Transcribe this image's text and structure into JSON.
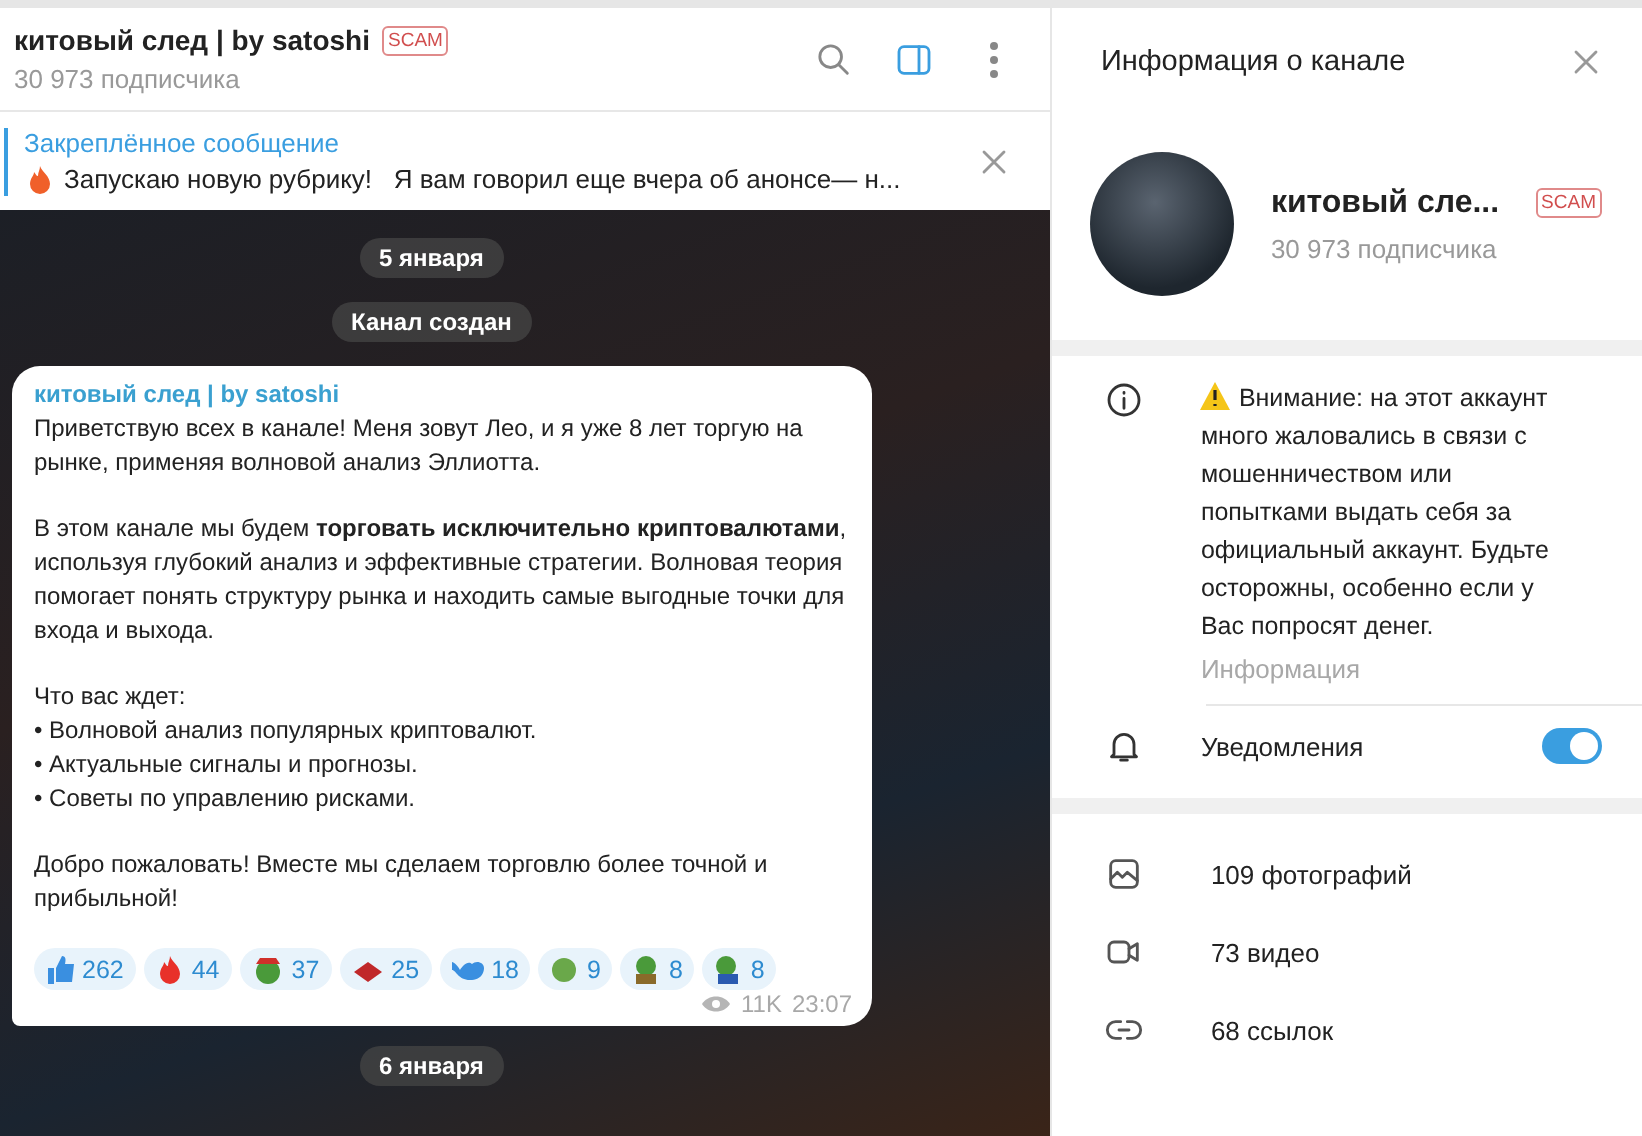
{
  "chat": {
    "title": "китовый след | by satoshi",
    "badge": "SCAM",
    "subtitle": "30 973 подписчика",
    "pinned": {
      "label": "Закреплённое сообщение",
      "text": "Запускаю новую рубрику!   Я вам говорил еще вчера об анонсе— н..."
    },
    "feed": [
      {
        "kind": "date",
        "text": "5 января"
      },
      {
        "kind": "service",
        "text": "Канал создан"
      },
      {
        "kind": "message",
        "author": "китовый след | by satoshi",
        "paragraphs": [
          [
            "Приветствую всех в канале! Меня зовут Лео, и я уже 8 лет торгую на рынке, применяя волновой анализ Эллиотта."
          ],
          [
            "В этом канале мы будем **торговать исключительно криптовалютами**, используя глубокий анализ и эффективные стратегии. Волновая теория помогает понять структуру рынка и находить самые выгодные точки для входа и выхода."
          ],
          [
            "Что вас ждет:",
            "• Волновой анализ популярных криптовалют.",
            "• Актуальные сигналы и прогнозы.",
            "• Советы по управлению рисками."
          ],
          [
            "Добро пожаловать! Вместе мы сделаем торговлю более точной и прибыльной!"
          ]
        ],
        "reactions": [
          {
            "count": "262"
          },
          {
            "count": "44"
          },
          {
            "count": "37"
          },
          {
            "count": "25"
          },
          {
            "count": "18"
          },
          {
            "count": "9"
          },
          {
            "count": "8"
          },
          {
            "count": "8"
          }
        ],
        "views": "11K",
        "time": "23:07"
      },
      {
        "kind": "date",
        "text": "6 января"
      }
    ]
  },
  "info": {
    "title": "Информация о канале",
    "name": "китовый сле...",
    "badge": "SCAM",
    "subtitle": "30 973 подписчика",
    "warning": "Внимание: на этот аккаунт много жаловались в связи с мошенничеством или попытками выдать себя за официальный аккаунт. Будьте осторожны, особенно если у Вас попросят денег.",
    "warning_label": "Информация",
    "notifications": {
      "label": "Уведомления",
      "on": true
    },
    "media": [
      {
        "kind": "photo",
        "label": "109 фотографий"
      },
      {
        "kind": "video",
        "label": "73 видео"
      },
      {
        "kind": "link",
        "label": "68 ссылок"
      }
    ]
  }
}
